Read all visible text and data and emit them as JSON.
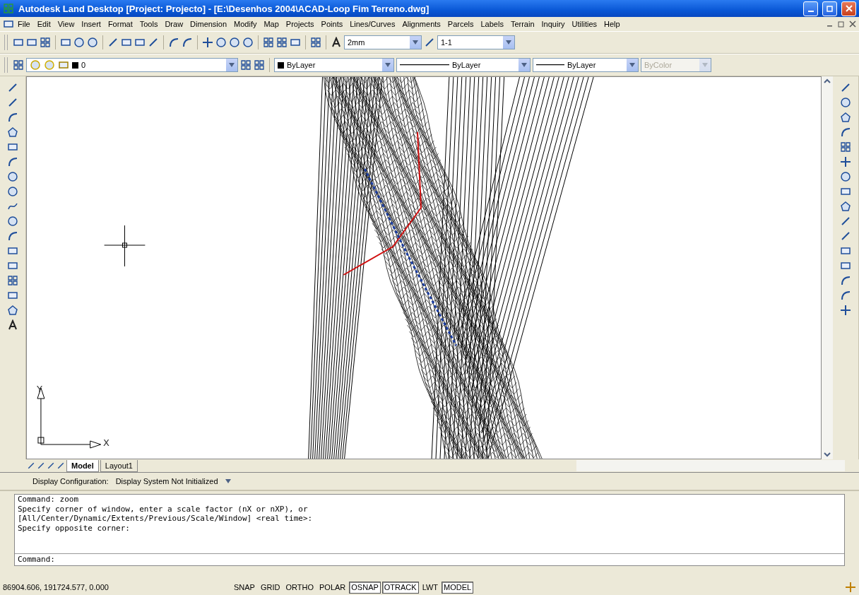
{
  "window": {
    "title": "Autodesk Land Desktop [Project: Projecto] - [E:\\Desenhos 2004\\ACAD-Loop Fim Terreno.dwg]"
  },
  "menu": [
    "File",
    "Edit",
    "View",
    "Insert",
    "Format",
    "Tools",
    "Draw",
    "Dimension",
    "Modify",
    "Map",
    "Projects",
    "Points",
    "Lines/Curves",
    "Alignments",
    "Parcels",
    "Labels",
    "Terrain",
    "Inquiry",
    "Utilities",
    "Help"
  ],
  "standard_toolbar": {
    "text_style": "2mm",
    "dim_style": "1-1"
  },
  "properties_toolbar": {
    "layer": "0",
    "color_setting": "ByLayer",
    "linetype": "ByLayer",
    "lineweight": "ByLayer",
    "plot_style": "ByColor",
    "plot_style_disabled": true
  },
  "canvas": {
    "axis_x": "X",
    "axis_y": "Y"
  },
  "layout_tabs": [
    {
      "label": "Model",
      "selected": true
    },
    {
      "label": "Layout1",
      "selected": false
    }
  ],
  "display_config": {
    "label": "Display Configuration:",
    "value": "Display System Not Initialized"
  },
  "command_history": [
    "Command: zoom",
    "Specify corner of window, enter a scale factor (nX or nXP), or",
    "[All/Center/Dynamic/Extents/Previous/Scale/Window] <real time>:",
    "Specify opposite corner:"
  ],
  "command_prompt": "Command:",
  "status_bar": {
    "coordinates": "86904.606, 191724.577, 0.000",
    "toggles": [
      {
        "label": "SNAP",
        "on": false
      },
      {
        "label": "GRID",
        "on": false
      },
      {
        "label": "ORTHO",
        "on": false
      },
      {
        "label": "POLAR",
        "on": false
      },
      {
        "label": "OSNAP",
        "on": true
      },
      {
        "label": "OTRACK",
        "on": true
      },
      {
        "label": "LWT",
        "on": false
      },
      {
        "label": "MODEL",
        "on": true
      }
    ]
  }
}
